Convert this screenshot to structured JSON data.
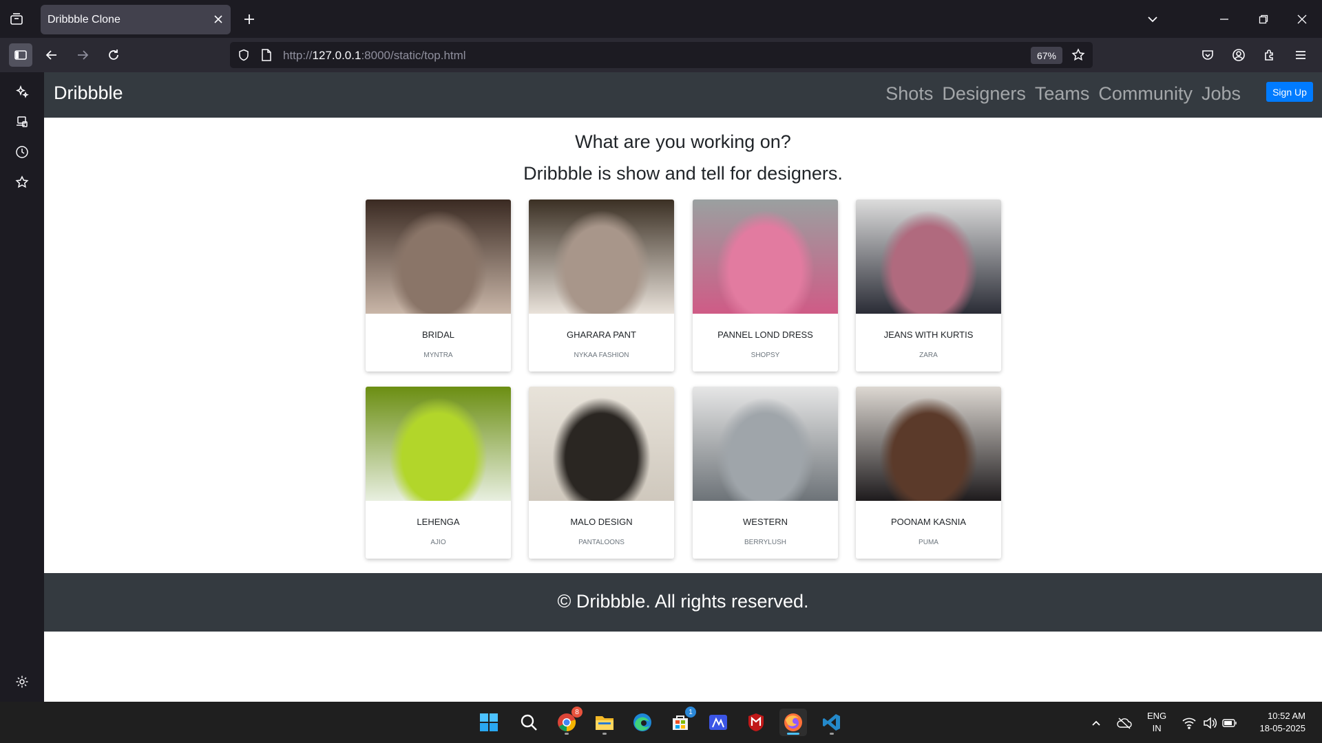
{
  "browser": {
    "tab_title": "Dribbble Clone",
    "url_prefix": "http://",
    "url_host": "127.0.0.1",
    "url_rest": ":8000/static/top.html",
    "zoom": "67%"
  },
  "site": {
    "brand": "Dribbble",
    "nav": [
      "Shots",
      "Designers",
      "Teams",
      "Community",
      "Jobs"
    ],
    "signup": "Sign Up",
    "hero_line1": "What are you working on?",
    "hero_line2": "Dribbble is show and tell for designers.",
    "footer": "© Dribbble. All rights reserved."
  },
  "cards": [
    {
      "name": "BRIDAL",
      "brand": "MYNTRA",
      "colors": [
        "#3a2a22",
        "#8a7568",
        "#c9b6a8"
      ]
    },
    {
      "name": "GHARARA PANT",
      "brand": "NYKAA FASHION",
      "colors": [
        "#3b3024",
        "#a8968a",
        "#e9e2da"
      ]
    },
    {
      "name": "PANNEL LOND DRESS",
      "brand": "SHOPSY",
      "colors": [
        "#9aa0a0",
        "#e27ba0",
        "#cf5b86"
      ]
    },
    {
      "name": "JEANS WITH KURTIS",
      "brand": "ZARA",
      "colors": [
        "#dcdcdc",
        "#b06a7e",
        "#2a2c36"
      ]
    },
    {
      "name": "LEHENGA",
      "brand": "AJIO",
      "colors": [
        "#6b8e12",
        "#b2d62a",
        "#e8efe0"
      ]
    },
    {
      "name": "MALO DESIGN",
      "brand": "PANTALOONS",
      "colors": [
        "#e8e3da",
        "#2a2622",
        "#cfc8bd"
      ]
    },
    {
      "name": "WESTERN",
      "brand": "BERRYLUSH",
      "colors": [
        "#e6e6e6",
        "#9fa5aa",
        "#6d7378"
      ]
    },
    {
      "name": "POONAM KASNIA",
      "brand": "PUMA",
      "colors": [
        "#ddd8d2",
        "#5b3a2a",
        "#1e1b1d"
      ]
    }
  ],
  "taskbar": {
    "lang_line1": "ENG",
    "lang_line2": "IN",
    "time": "10:52 AM",
    "date": "18-05-2025",
    "chrome_badge": "8",
    "store_badge": "1"
  }
}
